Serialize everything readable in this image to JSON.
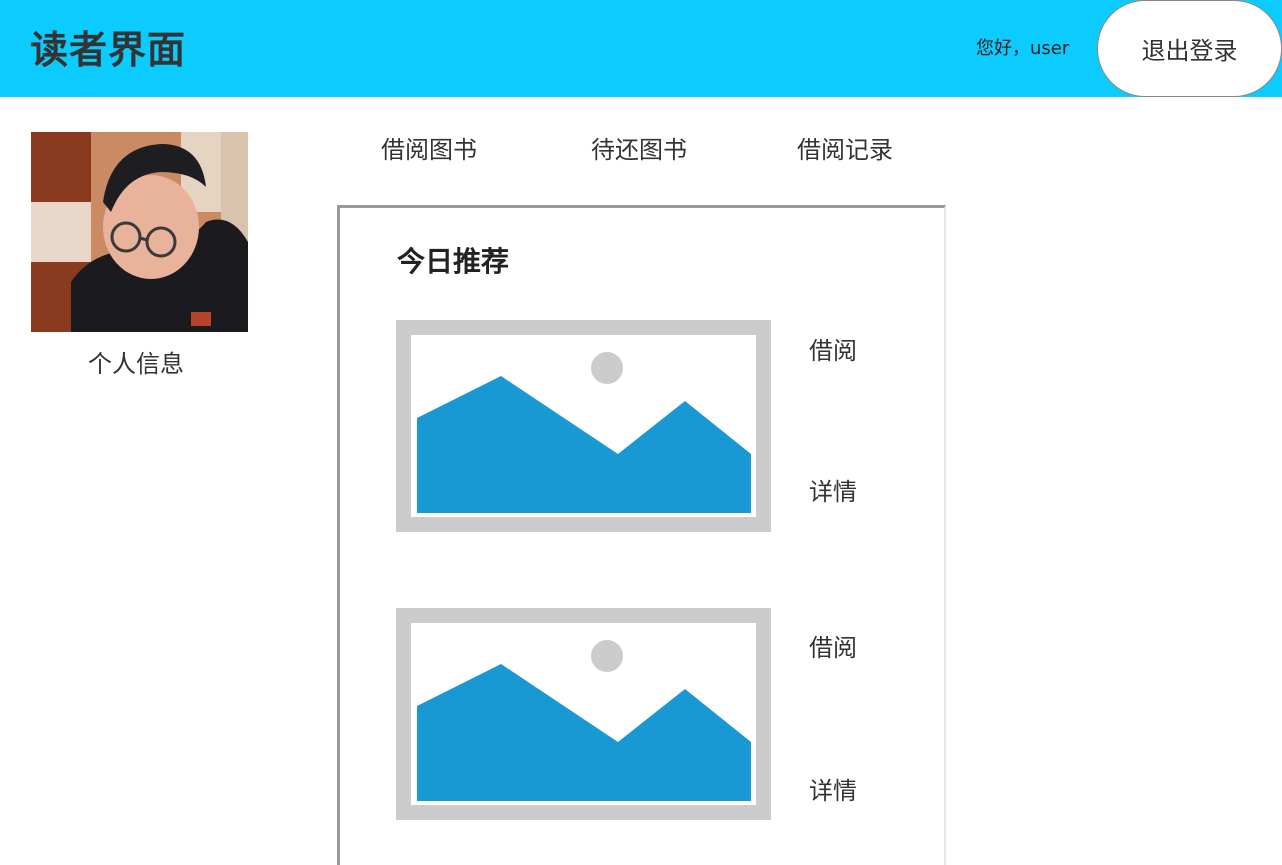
{
  "header": {
    "title": "读者界面",
    "greeting": "您好，user",
    "logout_label": "退出登录",
    "background_color": "#0bcbff"
  },
  "sidebar": {
    "avatar_icon": "user-photo",
    "profile_label": "个人信息"
  },
  "tabs": [
    {
      "label": "借阅图书"
    },
    {
      "label": "待还图书"
    },
    {
      "label": "借阅记录"
    }
  ],
  "recommend": {
    "title": "今日推荐",
    "books": [
      {
        "cover_icon": "image-placeholder-icon",
        "borrow_label": "借阅",
        "detail_label": "详情"
      },
      {
        "cover_icon": "image-placeholder-icon",
        "borrow_label": "借阅",
        "detail_label": "详情"
      }
    ]
  },
  "colors": {
    "placeholder_frame": "#cccccc",
    "placeholder_mountain": "#1899d3"
  }
}
